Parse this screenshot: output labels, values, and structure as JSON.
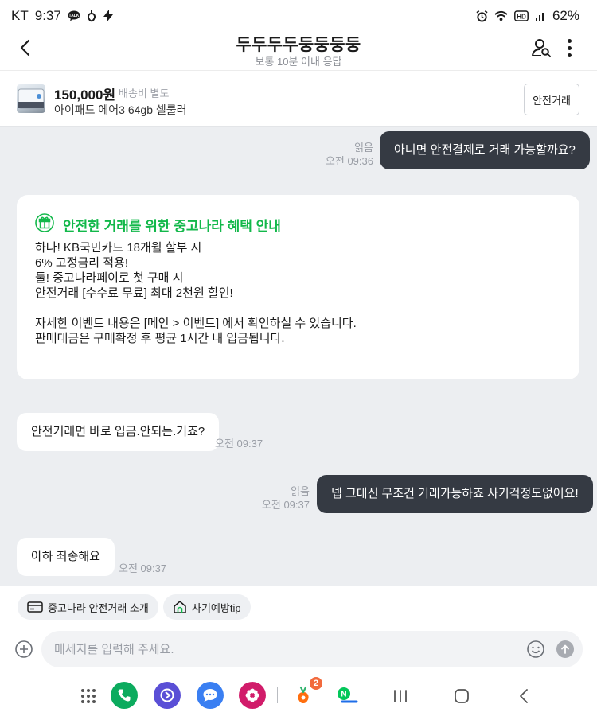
{
  "status_bar": {
    "carrier": "KT",
    "time": "9:37",
    "battery": "62%"
  },
  "header": {
    "title": "두두두두둥둥둥둥",
    "subtitle": "보통 10분 이내 응답"
  },
  "product": {
    "price": "150,000원",
    "shipping": "배송비 별도",
    "name": "아이패드 에어3 64gb 셀룰러",
    "safe_trade_button": "안전거래"
  },
  "messages": {
    "m1": {
      "text": "아니면 안전결제로 거래 가능할까요?",
      "read": "읽음",
      "time": "오전 09:36"
    },
    "notice": {
      "title": "안전한 거래를 위한 중고나라 혜택 안내",
      "lines": [
        "하나! KB국민카드 18개월 할부 시",
        "6% 고정금리 적용!",
        "둘! 중고나라페이로 첫 구매 시",
        "안전거래 [수수료 무료] 최대 2천원 할인!",
        "",
        "자세한 이벤트 내용은 [메인 > 이벤트] 에서 확인하실 수 있습니다.",
        "판매대금은 구매확정 후 평균 1시간 내 입금됩니다."
      ]
    },
    "m2": {
      "text": "안전거래면 바로 입금.안되는.거죠?",
      "time": "오전 09:37"
    },
    "m3": {
      "text": "넵 그대신 무조건 거래가능하죠 사기걱정도없어요!",
      "read": "읽음",
      "time": "오전 09:37"
    },
    "m4": {
      "text": "아하 죄송해요",
      "time": "오전 09:37"
    }
  },
  "chips": {
    "intro": "중고나라 안전거래 소개",
    "tip": "사기예방tip"
  },
  "composer": {
    "placeholder": "메세지를 입력해 주세요."
  },
  "dock": {
    "badge_count": "2"
  },
  "colors": {
    "accent_green": "#12b84a",
    "my_bubble": "#353a43",
    "chat_bg": "#eceef1"
  }
}
